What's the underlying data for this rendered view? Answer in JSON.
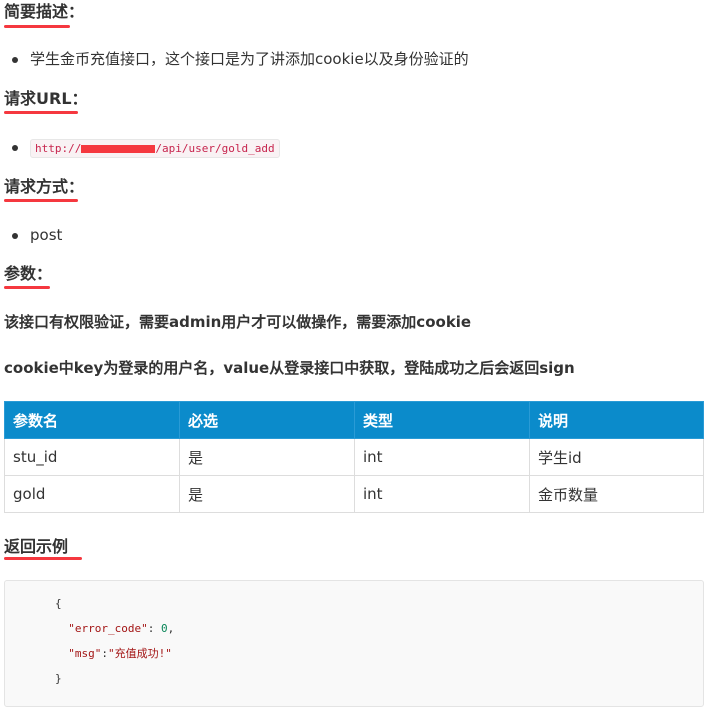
{
  "section_brief": {
    "title": "简要描述：",
    "items": [
      "学生金币充值接口，这个接口是为了讲添加cookie以及身份验证的"
    ]
  },
  "section_url": {
    "title": "请求URL：",
    "url_prefix": "http://",
    "url_suffix": "/api/user/gold_add"
  },
  "section_method": {
    "title": "请求方式：",
    "items": [
      "post"
    ]
  },
  "section_params": {
    "title": "参数：",
    "note1": "该接口有权限验证，需要admin用户才可以做操作，需要添加cookie",
    "note2": "cookie中key为登录的用户名，value从登录接口中获取，登陆成功之后会返回sign",
    "headers": [
      "参数名",
      "必选",
      "类型",
      "说明"
    ],
    "rows": [
      [
        "stu_id",
        "是",
        "int",
        "学生id"
      ],
      [
        "gold",
        "是",
        "int",
        "金币数量"
      ]
    ]
  },
  "section_example": {
    "title": "返回示例",
    "code": {
      "open": "{",
      "line1_key": "\"error_code\"",
      "line1_sep": ": ",
      "line1_val": "0",
      "line1_end": ",",
      "line2_key": "\"msg\"",
      "line2_sep": ":",
      "line2_val": "\"充值成功!\"",
      "close": "}"
    }
  },
  "colors": {
    "accent_underline": "#f5383f",
    "table_header": "#0b8bcb",
    "code_text": "#c7254e"
  }
}
